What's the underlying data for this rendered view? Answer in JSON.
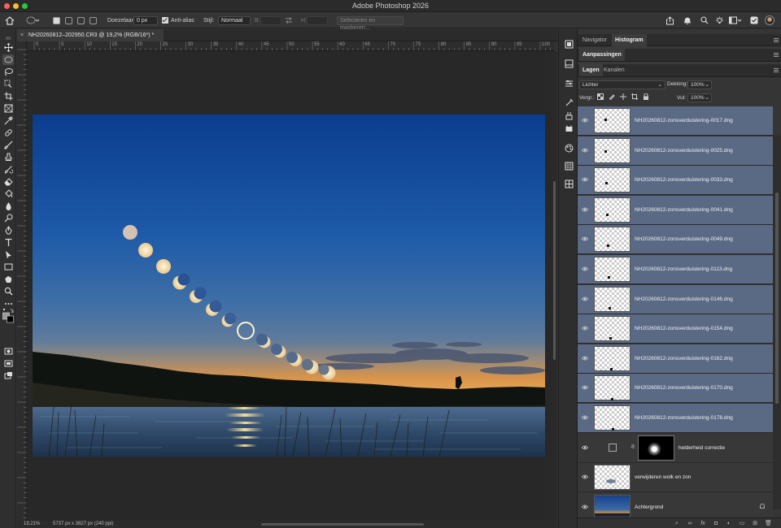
{
  "app_title": "Adobe Photoshop 2026",
  "options": {
    "feather_label": "Doezelaar:",
    "feather_value": "0 px",
    "antialias_label": "Anti-alias",
    "style_label": "Stijl:",
    "style_value": "Normaal",
    "width_label": "B:",
    "height_label": "H:",
    "select_mask_label": "Selecteren en maskeren..."
  },
  "document": {
    "tab_title": "NH20260812–202950.CR3 @ 19,2% (RGB/16*) *",
    "zoom": "19,21%",
    "doc_info": "5737 px x 3827 px (240 ppi)"
  },
  "ruler_top_labels": [
    "0",
    "5",
    "10",
    "15",
    "20",
    "25",
    "30",
    "35",
    "40",
    "45",
    "50",
    "55",
    "60",
    "65",
    "70",
    "75",
    "80",
    "85",
    "90",
    "95",
    "100"
  ],
  "panels": {
    "top_tabs": [
      {
        "label": "Navigator"
      },
      {
        "label": "Histogram"
      }
    ],
    "adjust_tab": "Aanpassingen",
    "layer_tabs": [
      {
        "label": "Lagen"
      },
      {
        "label": "Kanalen"
      }
    ],
    "blend_mode": "Lichter",
    "opacity_label": "Dekking:",
    "opacity_value": "100%",
    "lock_label": "Vergr.:",
    "fill_label": "Vul:",
    "fill_value": "100%"
  },
  "layers": [
    {
      "name": "NH20260812-zonsverduistering-0017.dng"
    },
    {
      "name": "NH20260812-zonsverduistering-0025.dng"
    },
    {
      "name": "NH20260812-zonsverduistering-0033.dng"
    },
    {
      "name": "NH20260812-zonsverduistering-0041.dng"
    },
    {
      "name": "NH20260812-zonsverduistering-0049.dng"
    },
    {
      "name": "NH20260812-zonsverduistering-0113.dng"
    },
    {
      "name": "NH20260812-zonsverduistering-0146.dng"
    },
    {
      "name": "NH20260812-zonsverduistering-0154.dng"
    },
    {
      "name": "NH20260812-zonsverduistering-0162.dng"
    },
    {
      "name": "NH20260812-zonsverduistering-0170.dng"
    },
    {
      "name": "NH20260812-zonsverduistering-0178.dng"
    },
    {
      "name": "helderheid correctie"
    },
    {
      "name": "verwijderen wolk en zon"
    },
    {
      "name": "Achtergrond"
    }
  ],
  "colors": {
    "selected_layer": "#5a6a85",
    "sky_top": "#0b3d8f",
    "horizon": "#d9944a"
  }
}
